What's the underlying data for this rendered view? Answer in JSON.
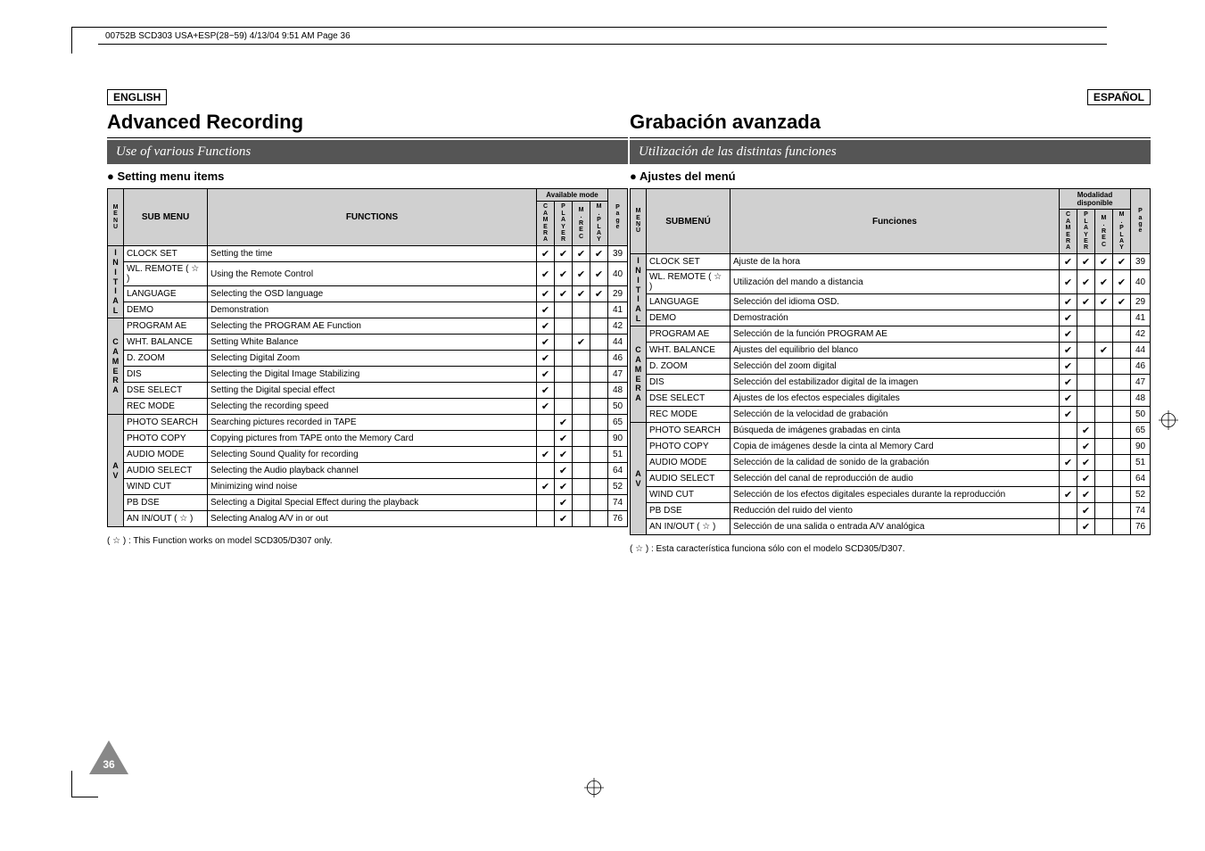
{
  "header_strip": "00752B SCD303 USA+ESP(28~59)  4/13/04 9:51 AM  Page 36",
  "page_number": "36",
  "left": {
    "lang": "ENGLISH",
    "title": "Advanced Recording",
    "subtitle": "Use of various Functions",
    "setting": "Setting menu items",
    "th_menu": "MENU",
    "th_sub": "SUB MENU",
    "th_func": "FUNCTIONS",
    "th_avail": "Available mode",
    "th_mode1": "CAMERA",
    "th_mode2": "PLAYER",
    "th_mode3": "M . REC",
    "th_mode4": "M . PLAY",
    "th_page": "Page",
    "footnote": "( ☆ )  : This Function works on model SCD305/D307 only.",
    "groups": [
      {
        "letters": "INITIAL",
        "rows": [
          {
            "sub": "CLOCK SET",
            "func": "Setting the time",
            "m": [
              1,
              1,
              1,
              1
            ],
            "pg": "39"
          },
          {
            "sub": "WL. REMOTE ( ☆ )",
            "func": "Using the Remote Control",
            "m": [
              1,
              1,
              1,
              1
            ],
            "pg": "40"
          },
          {
            "sub": "LANGUAGE",
            "func": "Selecting the OSD language",
            "m": [
              1,
              1,
              1,
              1
            ],
            "pg": "29"
          },
          {
            "sub": "DEMO",
            "func": "Demonstration",
            "m": [
              1,
              0,
              0,
              0
            ],
            "pg": "41"
          }
        ]
      },
      {
        "letters": "CAMERA",
        "rows": [
          {
            "sub": "PROGRAM AE",
            "func": "Selecting the PROGRAM AE Function",
            "m": [
              1,
              0,
              0,
              0
            ],
            "pg": "42"
          },
          {
            "sub": "WHT. BALANCE",
            "func": "Setting White Balance",
            "m": [
              1,
              0,
              1,
              0
            ],
            "pg": "44"
          },
          {
            "sub": "D. ZOOM",
            "func": "Selecting Digital Zoom",
            "m": [
              1,
              0,
              0,
              0
            ],
            "pg": "46"
          },
          {
            "sub": "DIS",
            "func": "Selecting the Digital Image Stabilizing",
            "m": [
              1,
              0,
              0,
              0
            ],
            "pg": "47"
          },
          {
            "sub": "DSE SELECT",
            "func": "Setting the Digital special effect",
            "m": [
              1,
              0,
              0,
              0
            ],
            "pg": "48"
          },
          {
            "sub": "REC MODE",
            "func": "Selecting the recording speed",
            "m": [
              1,
              0,
              0,
              0
            ],
            "pg": "50"
          }
        ]
      },
      {
        "letters": "AV",
        "rows": [
          {
            "sub": "PHOTO SEARCH",
            "func": "Searching pictures recorded in TAPE",
            "m": [
              0,
              1,
              0,
              0
            ],
            "pg": "65"
          },
          {
            "sub": "PHOTO COPY",
            "func": "Copying pictures from TAPE onto the Memory Card",
            "m": [
              0,
              1,
              0,
              0
            ],
            "pg": "90"
          },
          {
            "sub": "AUDIO MODE",
            "func": "Selecting Sound Quality for recording",
            "m": [
              1,
              1,
              0,
              0
            ],
            "pg": "51"
          },
          {
            "sub": "AUDIO SELECT",
            "func": "Selecting the Audio playback channel",
            "m": [
              0,
              1,
              0,
              0
            ],
            "pg": "64"
          },
          {
            "sub": "WIND CUT",
            "func": "Minimizing wind noise",
            "m": [
              1,
              1,
              0,
              0
            ],
            "pg": "52"
          },
          {
            "sub": "PB DSE",
            "func": "Selecting a Digital Special Effect during the playback",
            "m": [
              0,
              1,
              0,
              0
            ],
            "pg": "74"
          },
          {
            "sub": "AN IN/OUT ( ☆ )",
            "func": "Selecting Analog A/V in or out",
            "m": [
              0,
              1,
              0,
              0
            ],
            "pg": "76"
          }
        ]
      }
    ]
  },
  "right": {
    "lang": "ESPAÑOL",
    "title": "Grabación avanzada",
    "subtitle": "Utilización de las distintas funciones",
    "setting": "Ajustes del menú",
    "th_menu": "MENÚ",
    "th_sub": "SUBMENÚ",
    "th_func": "Funciones",
    "th_avail": "Modalidad disponible",
    "th_mode1": "CAMERA",
    "th_mode2": "PLAYER",
    "th_mode3": "M . REC",
    "th_mode4": "M . PLAY",
    "th_page": "Page",
    "footnote": "( ☆ )  : Esta característica funciona sólo con el modelo SCD305/D307.",
    "groups": [
      {
        "letters": "INITIAL",
        "rows": [
          {
            "sub": "CLOCK SET",
            "func": "Ajuste de la hora",
            "m": [
              1,
              1,
              1,
              1
            ],
            "pg": "39"
          },
          {
            "sub": "WL. REMOTE ( ☆ )",
            "func": "Utilización del mando a distancia",
            "m": [
              1,
              1,
              1,
              1
            ],
            "pg": "40"
          },
          {
            "sub": "LANGUAGE",
            "func": "Selección del idioma OSD.",
            "m": [
              1,
              1,
              1,
              1
            ],
            "pg": "29"
          },
          {
            "sub": "DEMO",
            "func": "Demostración",
            "m": [
              1,
              0,
              0,
              0
            ],
            "pg": "41"
          }
        ]
      },
      {
        "letters": "CAMERA",
        "rows": [
          {
            "sub": "PROGRAM AE",
            "func": "Selección de la función PROGRAM AE",
            "m": [
              1,
              0,
              0,
              0
            ],
            "pg": "42"
          },
          {
            "sub": "WHT. BALANCE",
            "func": "Ajustes del equilibrio del blanco",
            "m": [
              1,
              0,
              1,
              0
            ],
            "pg": "44"
          },
          {
            "sub": "D. ZOOM",
            "func": "Selección del zoom digital",
            "m": [
              1,
              0,
              0,
              0
            ],
            "pg": "46"
          },
          {
            "sub": "DIS",
            "func": "Selección del estabilizador digital de la imagen",
            "m": [
              1,
              0,
              0,
              0
            ],
            "pg": "47"
          },
          {
            "sub": "DSE SELECT",
            "func": "Ajustes de los efectos especiales digitales",
            "m": [
              1,
              0,
              0,
              0
            ],
            "pg": "48"
          },
          {
            "sub": "REC MODE",
            "func": "Selección de la velocidad de grabación",
            "m": [
              1,
              0,
              0,
              0
            ],
            "pg": "50"
          }
        ]
      },
      {
        "letters": "AV",
        "rows": [
          {
            "sub": "PHOTO SEARCH",
            "func": "Búsqueda de imágenes grabadas en cinta",
            "m": [
              0,
              1,
              0,
              0
            ],
            "pg": "65"
          },
          {
            "sub": "PHOTO COPY",
            "func": "Copia de imágenes desde la cinta al Memory Card",
            "m": [
              0,
              1,
              0,
              0
            ],
            "pg": "90"
          },
          {
            "sub": "AUDIO MODE",
            "func": "Selección de la calidad de sonido de la grabación",
            "m": [
              1,
              1,
              0,
              0
            ],
            "pg": "51"
          },
          {
            "sub": "AUDIO SELECT",
            "func": "Selección del canal de reproducción de audio",
            "m": [
              0,
              1,
              0,
              0
            ],
            "pg": "64"
          },
          {
            "sub": "WIND CUT",
            "func": "Selección de los efectos digitales especiales durante la reproducción",
            "m": [
              1,
              1,
              0,
              0
            ],
            "pg": "52"
          },
          {
            "sub": "PB DSE",
            "func": "Reducción del ruido del viento",
            "m": [
              0,
              1,
              0,
              0
            ],
            "pg": "74"
          },
          {
            "sub": "AN IN/OUT ( ☆ )",
            "func": "Selección de una salida o entrada A/V analógica",
            "m": [
              0,
              1,
              0,
              0
            ],
            "pg": "76"
          }
        ]
      }
    ]
  }
}
